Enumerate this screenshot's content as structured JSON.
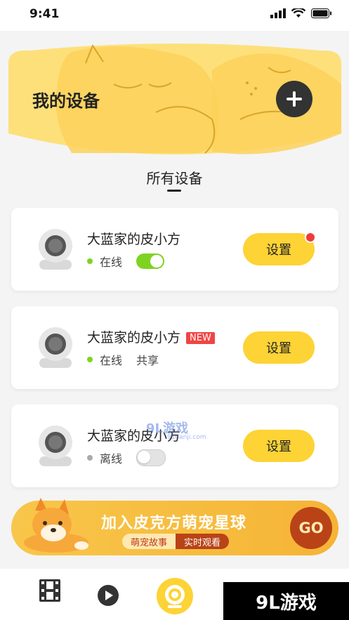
{
  "status_bar": {
    "time": "9:41"
  },
  "header": {
    "title": "我的设备"
  },
  "section": {
    "title": "所有设备"
  },
  "devices": [
    {
      "name": "大蓝家的皮小方",
      "status": "在线",
      "status_color": "#7ed321",
      "toggle_on": true,
      "settings_label": "设置",
      "has_red_dot": true
    },
    {
      "name": "大蓝家的皮小方",
      "badge": "NEW",
      "status": "在线",
      "share": "共享",
      "status_color": "#7ed321",
      "settings_label": "设置"
    },
    {
      "name": "大蓝家的皮小方",
      "status": "离线",
      "status_color": "#aaaaaa",
      "toggle_on": false,
      "settings_label": "设置"
    }
  ],
  "banner": {
    "title": "加入皮克方萌宠星球",
    "tag1": "萌宠故事",
    "tag2": "实时观看",
    "go_label": "GO"
  },
  "tabbar": {
    "items": [
      "film-icon",
      "play-icon",
      "camera-icon",
      "paw-icon"
    ]
  },
  "watermark": {
    "text": "9L游戏",
    "mid_text": "9L游戏",
    "mid_sub": "91danji.com"
  },
  "colors": {
    "accent": "#fdd335",
    "online": "#7ed321",
    "offline": "#aaaaaa",
    "banner_dark": "#b94317"
  }
}
